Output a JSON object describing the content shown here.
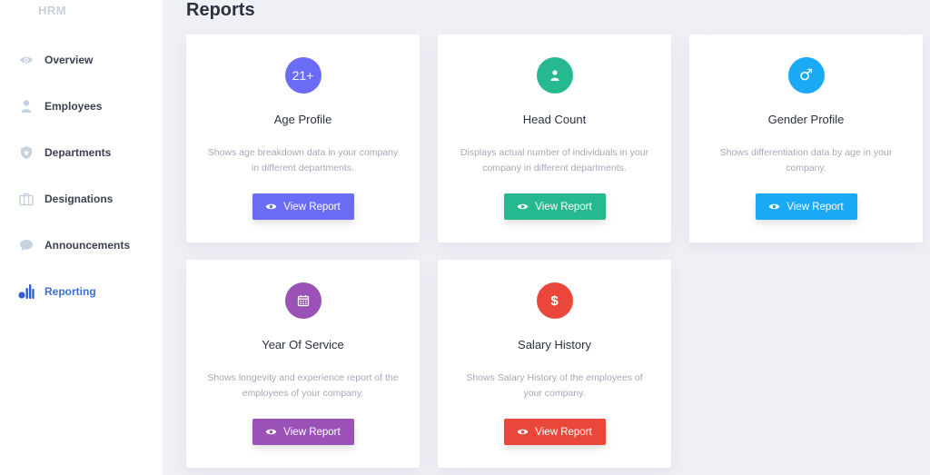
{
  "brand": "HRM",
  "sidebar": {
    "items": [
      {
        "label": "Overview",
        "icon": "eye-icon"
      },
      {
        "label": "Employees",
        "icon": "user-icon"
      },
      {
        "label": "Departments",
        "icon": "shield-icon"
      },
      {
        "label": "Designations",
        "icon": "briefcase-icon"
      },
      {
        "label": "Announcements",
        "icon": "chat-bubble-icon"
      },
      {
        "label": "Reporting",
        "icon": "bar-chart-icon",
        "active": true
      }
    ]
  },
  "page": {
    "title": "Reports"
  },
  "cards": [
    {
      "title": "Age Profile",
      "icon_text": "21+",
      "icon": "age-icon",
      "color": "#6a6cf6",
      "description": "Shows age breakdown data in your company in different departments.",
      "button": "View Report"
    },
    {
      "title": "Head Count",
      "icon": "person-icon",
      "color": "#26b98f",
      "description": "Displays actual number of individuals in your company in different departments.",
      "button": "View Report"
    },
    {
      "title": "Gender Profile",
      "icon_text": "♂",
      "icon": "male-symbol-icon",
      "color": "#1aa9f5",
      "description": "Shows differentiation data by age in your company.",
      "button": "View Report"
    },
    {
      "title": "Year Of Service",
      "icon": "calendar-icon",
      "color": "#9b52b6",
      "description": "Shows longevity and experience report of the employees of your company.",
      "button": "View Report"
    },
    {
      "title": "Salary History",
      "icon_text": "$",
      "icon": "dollar-icon",
      "color": "#ea463a",
      "description": "Shows Salary History of the employees of your company.",
      "button": "View Report"
    }
  ]
}
